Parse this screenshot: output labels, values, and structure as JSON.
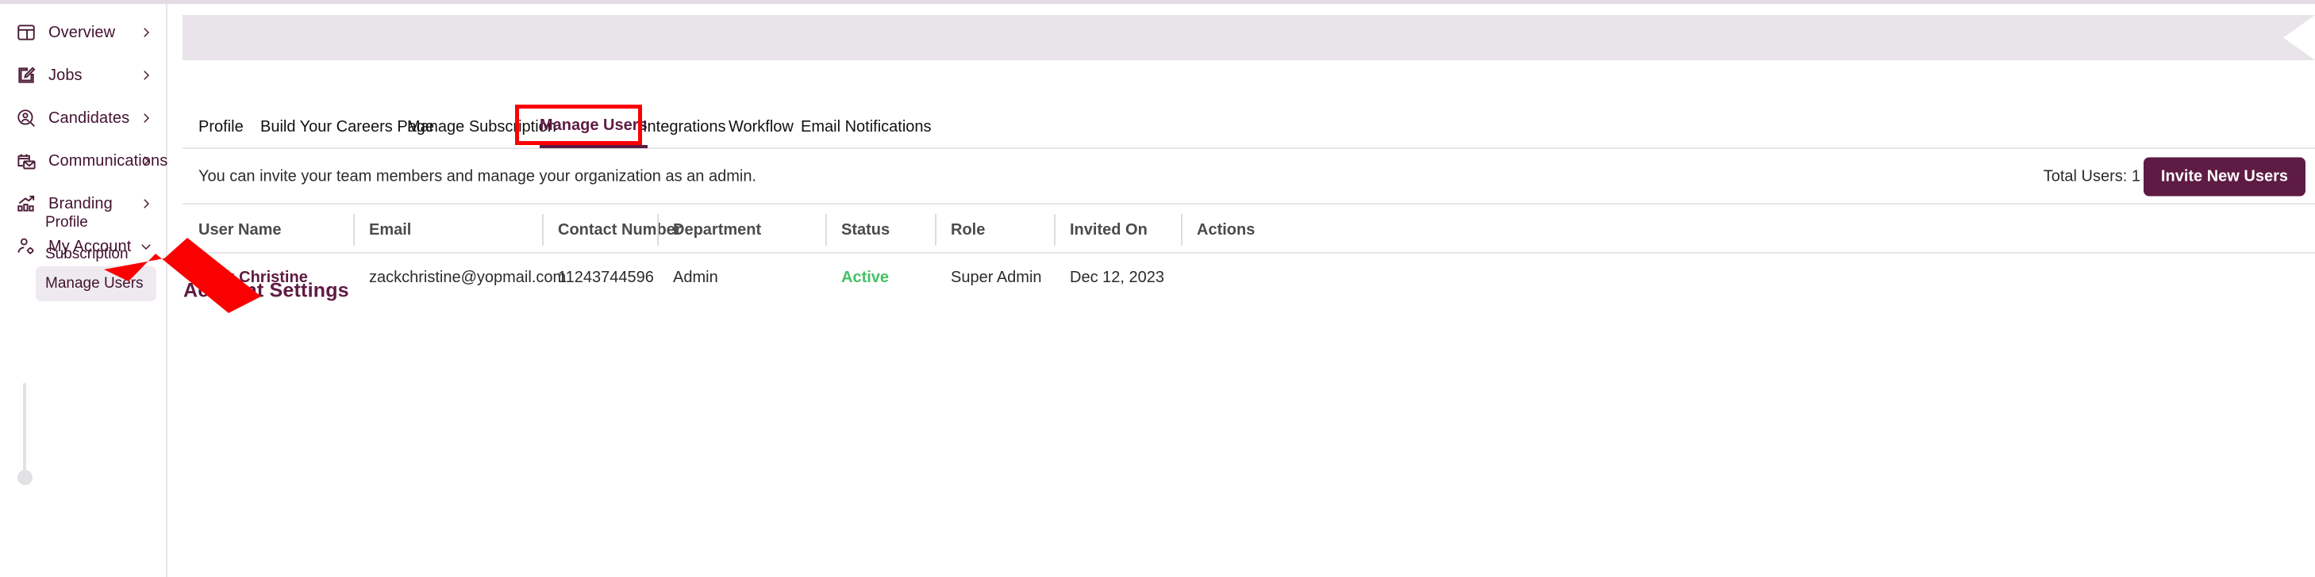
{
  "sidebar": {
    "items": [
      {
        "label": "Overview",
        "icon": "dashboard-icon",
        "chevron": "chevron-right"
      },
      {
        "label": "Jobs",
        "icon": "edit-square-icon",
        "chevron": "chevron-right"
      },
      {
        "label": "Candidates",
        "icon": "user-search-icon",
        "chevron": "chevron-right"
      },
      {
        "label": "Communications",
        "icon": "mail-calendar-icon",
        "chevron": "chevron-right"
      },
      {
        "label": "Branding",
        "icon": "bar-chart-up-icon",
        "chevron": "chevron-right"
      },
      {
        "label": "My Account",
        "icon": "user-gear-icon",
        "chevron": "chevron-down"
      }
    ],
    "sub_items": [
      {
        "label": "Profile",
        "active": false
      },
      {
        "label": "Subscription",
        "active": false
      },
      {
        "label": "Manage Users",
        "active": true
      }
    ]
  },
  "header": {
    "title": "Account Settings"
  },
  "tabs": [
    {
      "label": "Profile",
      "active": false
    },
    {
      "label": "Build Your Careers Page",
      "active": false
    },
    {
      "label": "Manage Subscription",
      "active": false
    },
    {
      "label": "Manage Users",
      "active": true
    },
    {
      "label": "Integrations",
      "active": false
    },
    {
      "label": "Workflow",
      "active": false
    },
    {
      "label": "Email Notifications",
      "active": false
    }
  ],
  "infobar": {
    "description": "You can invite your team members and manage your organization as an admin.",
    "total_users": "Total Users: 1",
    "invite_button": "Invite New Users"
  },
  "table": {
    "columns": [
      "User Name",
      "Email",
      "Contact Number",
      "Department",
      "Status",
      "Role",
      "Invited On",
      "Actions"
    ],
    "rows": [
      {
        "user_name": "Zack Christine",
        "email": "zackchristine@yopmail.com",
        "contact_number": "11243744596",
        "department": "Admin",
        "status": "Active",
        "role": "Super Admin",
        "invited_on": "Dec 12, 2023",
        "actions": ""
      }
    ]
  },
  "annotation": {
    "highlight_target": "Manage Users",
    "arrow_color": "#fb0000",
    "box_color": "#fb0000"
  },
  "colors": {
    "brand_purple": "#5e1b43",
    "banner_grey": "#e8e4e9",
    "status_green": "#45c266",
    "annotation_red": "#fb0000"
  }
}
